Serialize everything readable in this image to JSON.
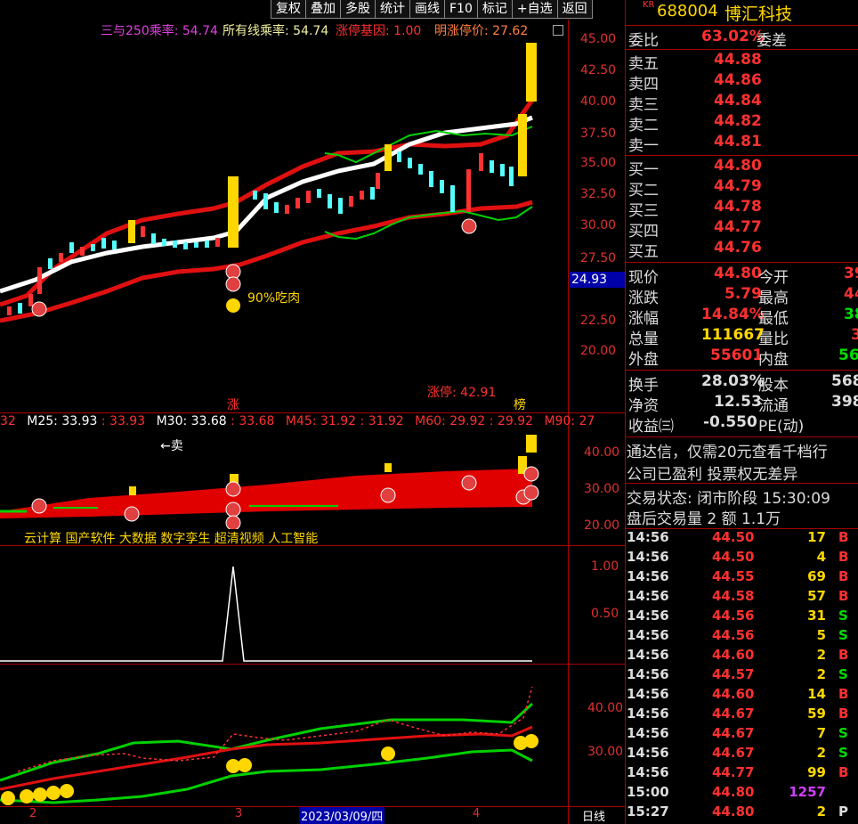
{
  "toolbar": [
    "复权",
    "叠加",
    "多股",
    "统计",
    "画线",
    "F10",
    "标记",
    "+自选",
    "返回"
  ],
  "main_indicators": {
    "i1": "三与250乘率: 54.74",
    "i2": "所有线乘率: 54.74",
    "i3": "涨停基因: 1.00",
    "i4": "明涨停价: 27.62"
  },
  "price_axis": [
    "45.00",
    "42.50",
    "40.00",
    "37.50",
    "35.00",
    "32.50",
    "30.00",
    "27.50",
    "22.50",
    "20.00"
  ],
  "current_price_tag": "24.93",
  "annotations": {
    "eat": "90%吃肉",
    "limit": "涨停: 42.91",
    "zhang": "涨",
    "bang": "榜"
  },
  "ma_line": {
    "m0": "32",
    "m25": "M25: 33.93",
    "m25v": ": 33.93",
    "m30": "M30: 33.68",
    "m30v": ": 33.68",
    "m45": "M45: 31.92",
    "m45v": ": 31.92",
    "m60": "M60: 29.92",
    "m60v": ": 29.92",
    "m90": "M90: 27"
  },
  "panel2_axis": [
    "40.00",
    "30.00",
    "20.00"
  ],
  "panel2_sell": "←卖",
  "concepts": "云计算 国产软件 大数据 数字孪生 超清视频 人工智能",
  "panel3_axis": [
    "1.00",
    "0.50"
  ],
  "panel4_axis": [
    "40.00",
    "30.00"
  ],
  "bottom": {
    "d2": "2",
    "d3": "3",
    "date": "2023/03/09/四",
    "d4": "4",
    "period": "日线"
  },
  "stock": {
    "code": "688004",
    "name": "博汇科技",
    "prefix": "KR"
  },
  "wei": {
    "label_bi": "委比",
    "bi": "63.02%",
    "label_cha": "委差"
  },
  "asks": [
    {
      "label": "卖五",
      "price": "44.88"
    },
    {
      "label": "卖四",
      "price": "44.86"
    },
    {
      "label": "卖三",
      "price": "44.84"
    },
    {
      "label": "卖二",
      "price": "44.82"
    },
    {
      "label": "卖一",
      "price": "44.81"
    }
  ],
  "bids": [
    {
      "label": "买一",
      "price": "44.80"
    },
    {
      "label": "买二",
      "price": "44.79"
    },
    {
      "label": "买三",
      "price": "44.78"
    },
    {
      "label": "买四",
      "price": "44.77"
    },
    {
      "label": "买五",
      "price": "44.76"
    }
  ],
  "quote": [
    {
      "l": "现价",
      "v": "44.80",
      "l2": "今开",
      "v2": "39"
    },
    {
      "l": "涨跌",
      "v": "5.79",
      "l2": "最高",
      "v2": "44"
    },
    {
      "l": "涨幅",
      "v": "14.84%",
      "l2": "最低",
      "v2": "38"
    },
    {
      "l": "总量",
      "v": "111667",
      "l2": "量比",
      "v2": "3"
    },
    {
      "l": "外盘",
      "v": "55601",
      "l2": "内盘",
      "v2": "56"
    }
  ],
  "fin": [
    {
      "l": "换手",
      "v": "28.03%",
      "l2": "股本",
      "v2": "568"
    },
    {
      "l": "净资",
      "v": "12.53",
      "l2": "流通",
      "v2": "398"
    },
    {
      "l": "收益㈢",
      "v": "-0.550",
      "l2": "PE(动)",
      "v2": ""
    }
  ],
  "notice1": "通达信，仅需20元查看千档行",
  "notice2": "公司已盈利 投票权无差异",
  "trade_state": "交易状态: 闭市阶段 15:30:09",
  "after_hours": "盘后交易量 2 额 1.1万",
  "ticks": [
    {
      "t": "14:56",
      "p": "44.50",
      "v": "17",
      "s": "B"
    },
    {
      "t": "14:56",
      "p": "44.50",
      "v": "4",
      "s": "B"
    },
    {
      "t": "14:56",
      "p": "44.55",
      "v": "69",
      "s": "B"
    },
    {
      "t": "14:56",
      "p": "44.58",
      "v": "57",
      "s": "B"
    },
    {
      "t": "14:56",
      "p": "44.56",
      "v": "31",
      "s": "S"
    },
    {
      "t": "14:56",
      "p": "44.56",
      "v": "5",
      "s": "S"
    },
    {
      "t": "14:56",
      "p": "44.60",
      "v": "2",
      "s": "B"
    },
    {
      "t": "14:56",
      "p": "44.57",
      "v": "2",
      "s": "S"
    },
    {
      "t": "14:56",
      "p": "44.60",
      "v": "14",
      "s": "B"
    },
    {
      "t": "14:56",
      "p": "44.67",
      "v": "59",
      "s": "B"
    },
    {
      "t": "14:56",
      "p": "44.67",
      "v": "7",
      "s": "S"
    },
    {
      "t": "14:56",
      "p": "44.67",
      "v": "2",
      "s": "S"
    },
    {
      "t": "14:56",
      "p": "44.77",
      "v": "99",
      "s": "B"
    },
    {
      "t": "15:00",
      "p": "44.80",
      "v": "1257",
      "s": ""
    },
    {
      "t": "15:27",
      "p": "44.80",
      "v": "2",
      "s": "P"
    }
  ],
  "colors": {
    "up": "#ff3232",
    "down": "#54ffff",
    "yellow": "#ffd700",
    "green": "#00e000",
    "border": "#a00000"
  }
}
